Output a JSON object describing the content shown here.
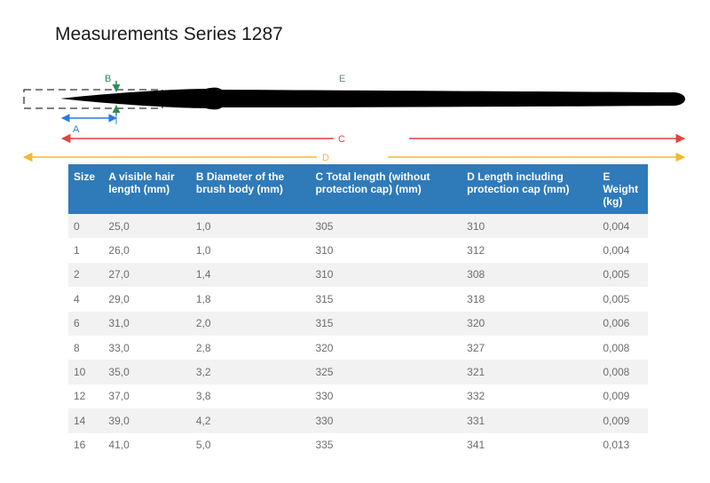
{
  "title": "Measurements Series 1287",
  "diagram": {
    "labels": {
      "a": "A",
      "b": "B",
      "c": "C",
      "d": "D",
      "e": "E"
    },
    "colors": {
      "a": "#2a7be4",
      "b": "#2e8b57",
      "c": "#e8403f",
      "d": "#f5b82e",
      "e": "#6a8b8b",
      "brush": "#000000",
      "cap_outline": "#333333"
    }
  },
  "table": {
    "header_color": "#2f7ab9",
    "columns": [
      "Size",
      "A visible hair length (mm)",
      "B Diameter of the brush body (mm)",
      "C Total length (without protection cap) (mm)",
      "D Length including protection cap (mm)",
      "E Weight (kg)"
    ],
    "rows": [
      [
        "0",
        "25,0",
        "1,0",
        "305",
        "310",
        "0,004"
      ],
      [
        "1",
        "26,0",
        "1,0",
        "310",
        "312",
        "0,004"
      ],
      [
        "2",
        "27,0",
        "1,4",
        "310",
        "308",
        "0,005"
      ],
      [
        "4",
        "29,0",
        "1,8",
        "315",
        "318",
        "0,005"
      ],
      [
        "6",
        "31,0",
        "2,0",
        "315",
        "320",
        "0,006"
      ],
      [
        "8",
        "33,0",
        "2,8",
        "320",
        "327",
        "0,008"
      ],
      [
        "10",
        "35,0",
        "3,2",
        "325",
        "321",
        "0,008"
      ],
      [
        "12",
        "37,0",
        "3,8",
        "330",
        "332",
        "0,009"
      ],
      [
        "14",
        "39,0",
        "4,2",
        "330",
        "331",
        "0,009"
      ],
      [
        "16",
        "41,0",
        "5,0",
        "335",
        "341",
        "0,013"
      ]
    ]
  }
}
